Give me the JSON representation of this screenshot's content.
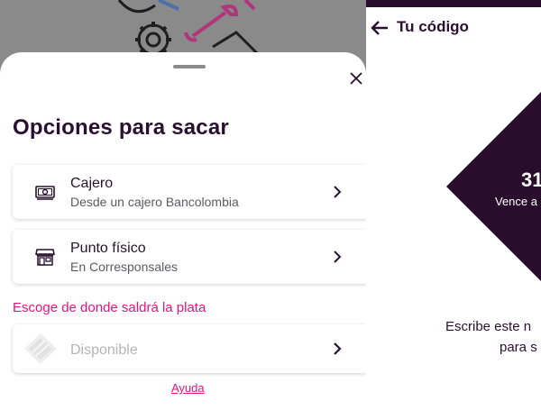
{
  "sheet": {
    "title": "Opciones para sacar",
    "options": [
      {
        "title": "Cajero",
        "subtitle": "Desde un cajero Bancolombia",
        "icon": "cash-icon"
      },
      {
        "title": "Punto físico",
        "subtitle": "En Corresponsales",
        "icon": "store-icon"
      }
    ],
    "source_prompt": "Escoge de donde saldrá la plata",
    "account": {
      "label": "Disponible",
      "state": "disabled"
    },
    "help_link": "Ayuda"
  },
  "code_screen": {
    "title": "Tu código",
    "code_partial": "31",
    "expiry_partial": "Vence a",
    "instruction_line1": "Escribe este n",
    "instruction_line2": "para s"
  },
  "colors": {
    "accent_pink": "#e0157f",
    "dark_purple": "#2a0c2c",
    "text": "#2a1030",
    "overlay": "#8a8a8a"
  }
}
